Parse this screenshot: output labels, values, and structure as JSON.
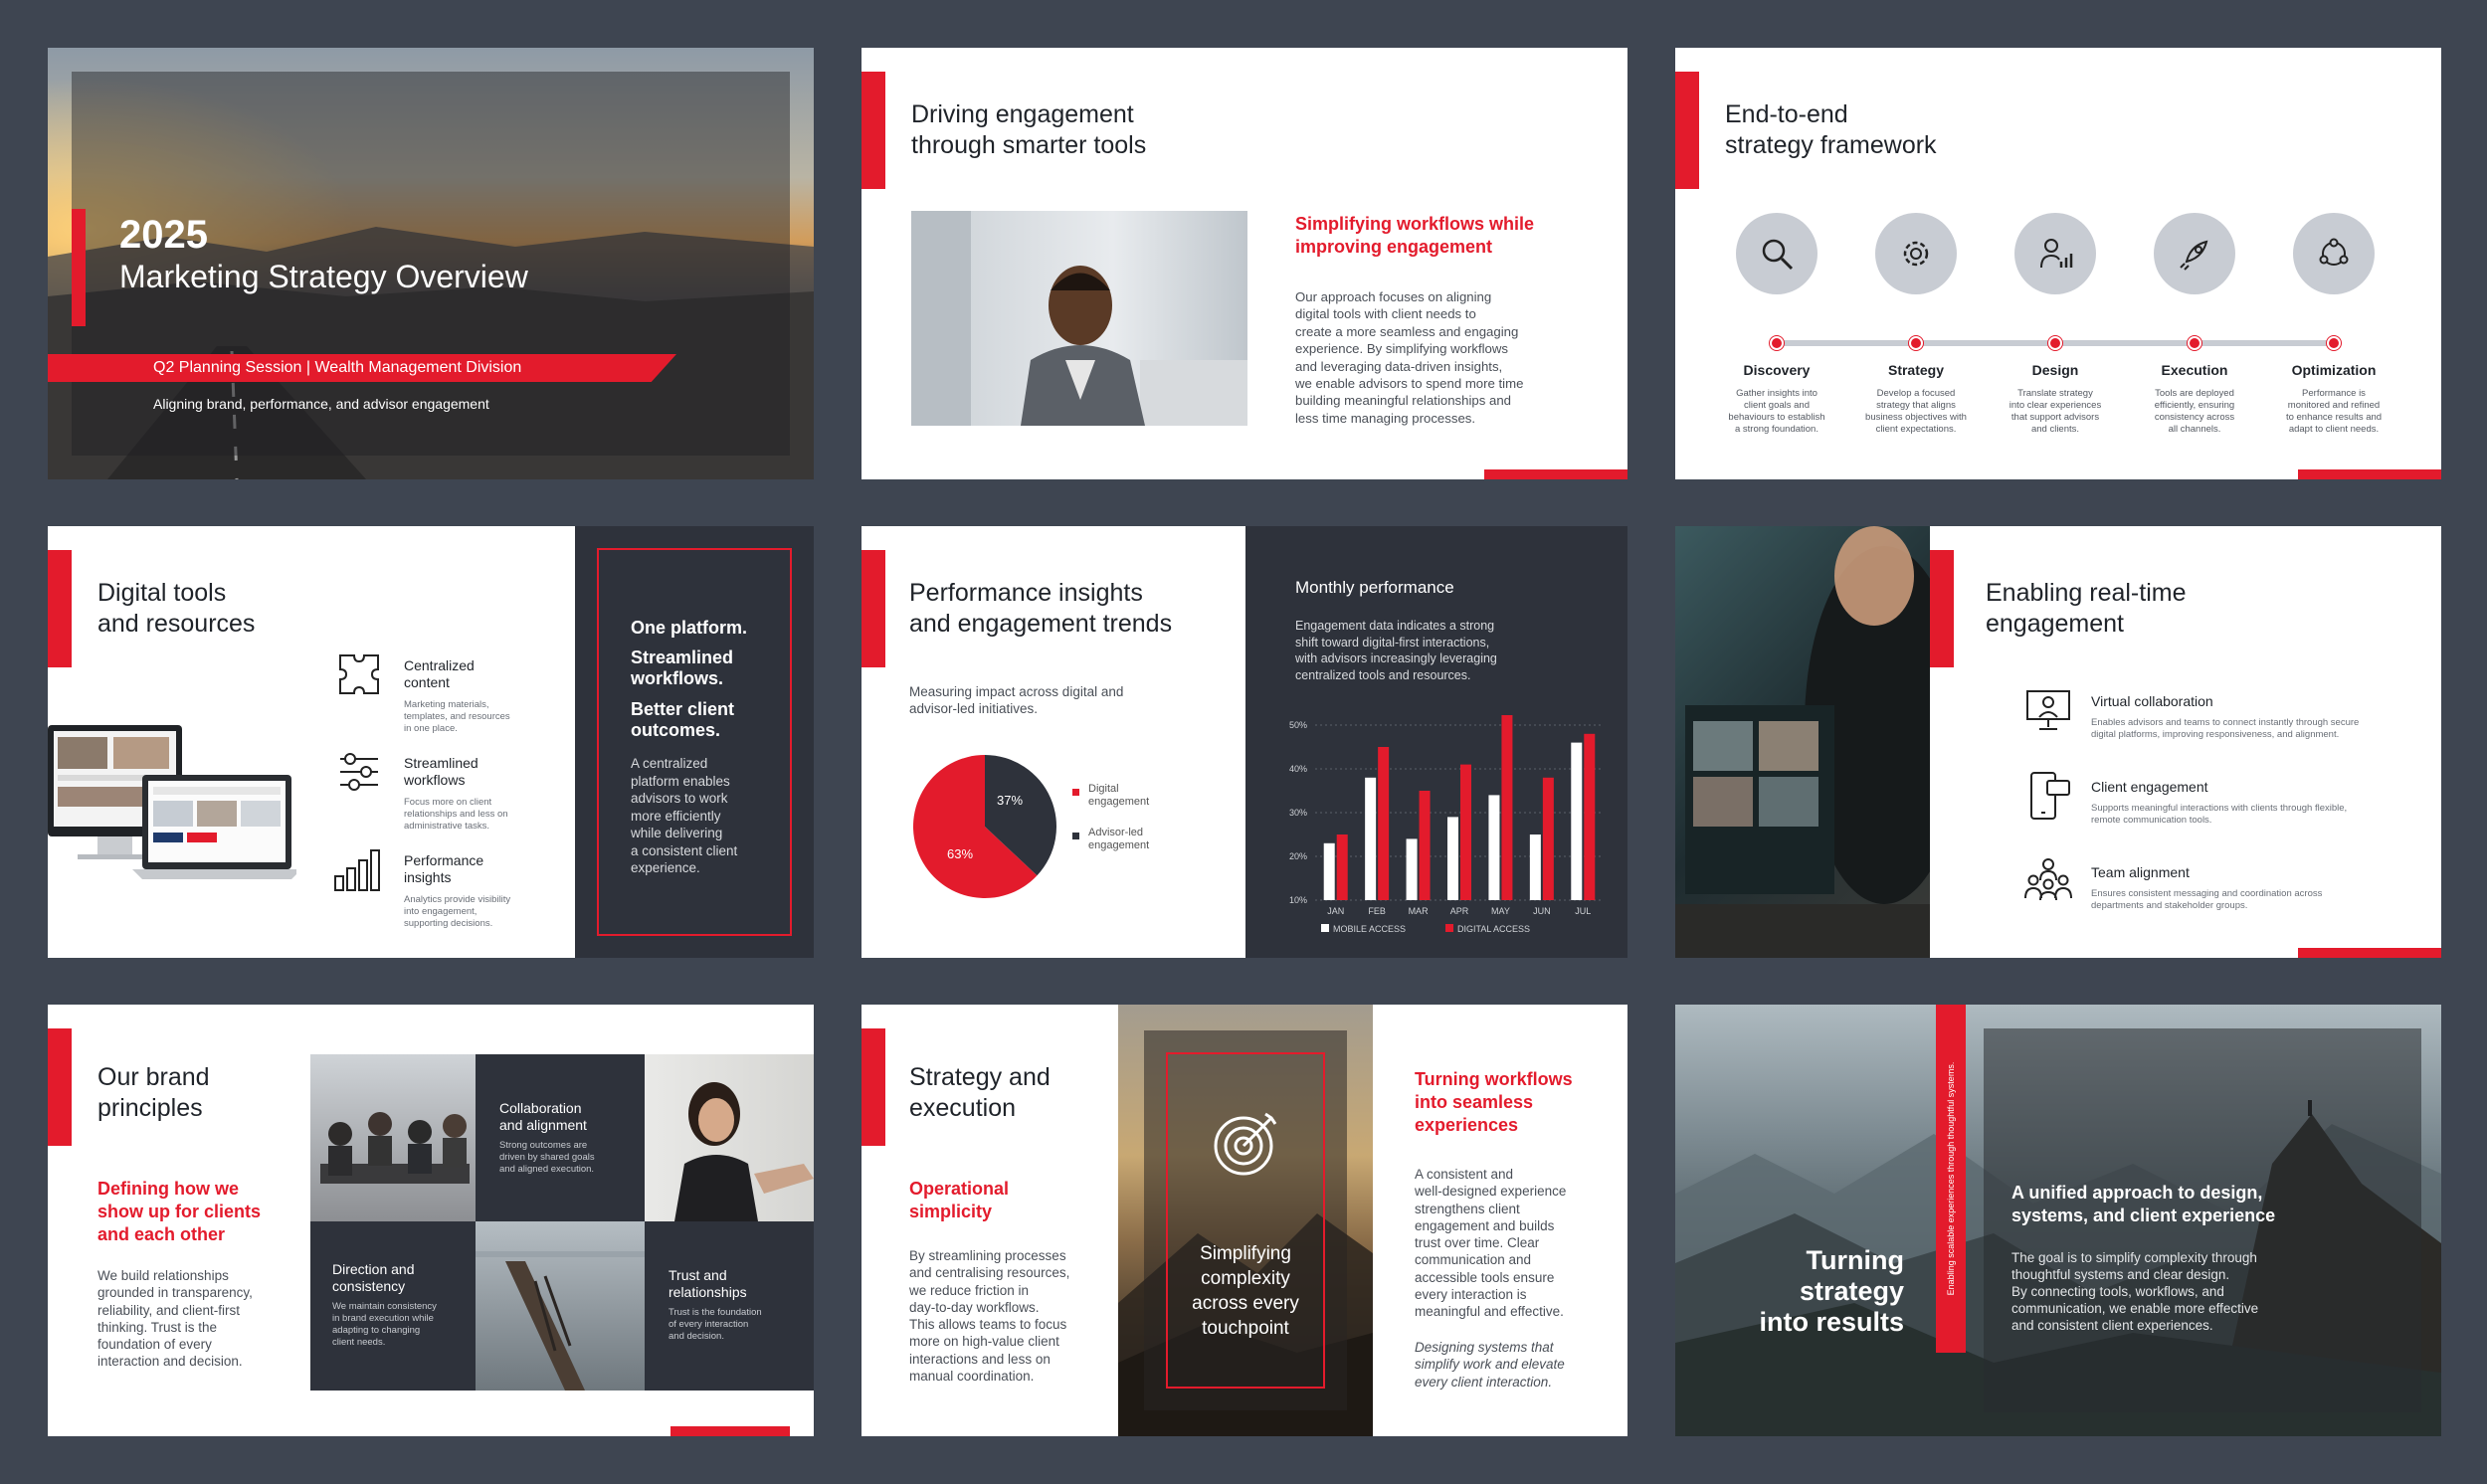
{
  "colors": {
    "accent": "#e31b2c",
    "dark": "#2e323b",
    "background": "#3e4551"
  },
  "s1": {
    "year": "2025",
    "title": "Marketing Strategy Overview",
    "ribbon": "Q2 Planning Session | Wealth Management Division",
    "tagline": "Aligning brand, performance, and advisor engagement"
  },
  "s2": {
    "title": "Driving engagement\nthrough smarter tools",
    "subtitle": "Simplifying workflows while\nimproving engagement",
    "body": "Our approach focuses on aligning\ndigital tools with client needs to\ncreate a more seamless and engaging\nexperience. By simplifying workflows\nand leveraging data-driven insights,\nwe enable advisors to spend more time\nbuilding meaningful relationships and\nless time managing processes."
  },
  "s3": {
    "title": "End-to-end\nstrategy framework",
    "steps": [
      {
        "name": "Discovery",
        "desc": "Gather insights into\nclient goals and\nbehaviours to establish\na strong foundation.",
        "icon": "magnifier-icon"
      },
      {
        "name": "Strategy",
        "desc": "Develop a focused\nstrategy that aligns\nbusiness objectives with\nclient expectations.",
        "icon": "gear-icon"
      },
      {
        "name": "Design",
        "desc": "Translate strategy\ninto clear experiences\nthat support advisors\nand clients.",
        "icon": "person-chart-icon"
      },
      {
        "name": "Execution",
        "desc": "Tools are deployed\nefficiently, ensuring\nconsistency across\nall channels.",
        "icon": "rocket-icon"
      },
      {
        "name": "Optimization",
        "desc": "Performance is\nmonitored and refined\nto enhance results and\nadapt to client needs.",
        "icon": "network-icon"
      }
    ]
  },
  "s4": {
    "title": "Digital tools\nand resources",
    "features": [
      {
        "name": "Centralized\ncontent",
        "desc": "Marketing materials,\ntemplates, and resources\nin one place.",
        "icon": "puzzle-icon"
      },
      {
        "name": "Streamlined\nworkflows",
        "desc": "Focus more on client\nrelationships and less on\nadministrative tasks.",
        "icon": "sliders-icon"
      },
      {
        "name": "Performance\ninsights",
        "desc": "Analytics provide visibility\ninto engagement,\nsupporting decisions.",
        "icon": "bar-chart-icon"
      }
    ],
    "panel_line1": "One platform.",
    "panel_line2": "Streamlined\nworkflows.",
    "panel_line3": "Better client\noutcomes.",
    "panel_body": "A centralized\nplatform enables\nadvisors to work\nmore efficiently\nwhile delivering\na consistent client\nexperience."
  },
  "s5": {
    "title": "Performance insights\nand engagement trends",
    "subtitle": "Measuring impact across digital and\nadvisor-led initiatives.",
    "pie": {
      "digital_label": "Digital\nengagement",
      "advisor_label": "Advisor-led\nengagement",
      "digital_pct": 63,
      "advisor_pct": 37,
      "digital_text": "63%",
      "advisor_text": "37%"
    },
    "panel_title": "Monthly performance",
    "panel_body": "Engagement data indicates a strong\nshift toward digital-first interactions,\nwith advisors increasingly leveraging\ncentralized tools and resources."
  },
  "chart_data": {
    "type": "bar",
    "categories": [
      "JAN",
      "FEB",
      "MAR",
      "APR",
      "MAY",
      "JUN",
      "JUL"
    ],
    "yticks": [
      "10%",
      "20%",
      "30%",
      "40%",
      "50%"
    ],
    "ylim": [
      10,
      50
    ],
    "series": [
      {
        "name": "MOBILE ACCESS",
        "values": [
          23,
          38,
          24,
          29,
          34,
          25,
          46
        ]
      },
      {
        "name": "DIGITAL ACCESS",
        "values": [
          25,
          45,
          35,
          41,
          53,
          38,
          48
        ]
      }
    ]
  },
  "s6": {
    "title": "Enabling real-time\nengagement",
    "features": [
      {
        "name": "Virtual collaboration",
        "desc": "Enables advisors and teams to connect instantly through secure\ndigital platforms, improving responsiveness, and alignment.",
        "icon": "presentation-icon"
      },
      {
        "name": "Client engagement",
        "desc": "Supports meaningful interactions with clients through flexible,\nremote communication tools.",
        "icon": "phone-chat-icon"
      },
      {
        "name": "Team alignment",
        "desc": "Ensures consistent messaging and coordination across\ndepartments and stakeholder groups.",
        "icon": "team-icon"
      }
    ]
  },
  "s7": {
    "title": "Our brand\nprinciples",
    "subtitle": "Defining how we\nshow up for clients\nand each other",
    "body": "We build relationships\ngrounded in transparency,\nreliability, and client-first\nthinking. Trust is the\nfoundation of every\ninteraction and decision.",
    "tiles": [
      {
        "name": "Collaboration\nand alignment",
        "desc": "Strong outcomes are\ndriven by shared goals\nand aligned execution."
      },
      {
        "name": "Direction and\nconsistency",
        "desc": "We maintain consistency\nin brand execution while\nadapting to changing\nclient needs."
      },
      {
        "name": "Trust and\nrelationships",
        "desc": "Trust is the foundation\nof every interaction\nand decision."
      }
    ]
  },
  "s8": {
    "title": "Strategy and\nexecution",
    "subtitle": "Operational\nsimplicity",
    "body": "By streamlining processes\nand centralising resources,\nwe reduce friction in\nday-to-day workflows.\nThis allows teams to focus\nmore on high-value client\ninteractions and less on\nmanual coordination.",
    "overlay": "Simplifying\ncomplexity\nacross every\ntouchpoint",
    "right_title": "Turning workflows\ninto seamless\nexperiences",
    "right_body": "A consistent and\nwell-designed experience\nstrengthens client\nengagement and builds\ntrust over time. Clear\ncommunication and\naccessible tools ensure\nevery interaction is\nmeaningful and effective.",
    "right_quote": "Designing systems that\nsimplify work and elevate\nevery client interaction."
  },
  "s9": {
    "title": "Turning\nstrategy\ninto results",
    "vertical": "Enabling scalable experiences through thoughtful systems.",
    "panel_title": "A unified approach to design,\nsystems, and client experience",
    "panel_body": "The goal is to simplify complexity through\nthoughtful systems and clear design.\nBy connecting tools, workflows, and\ncommunication, we enable more effective\nand consistent client experiences."
  }
}
